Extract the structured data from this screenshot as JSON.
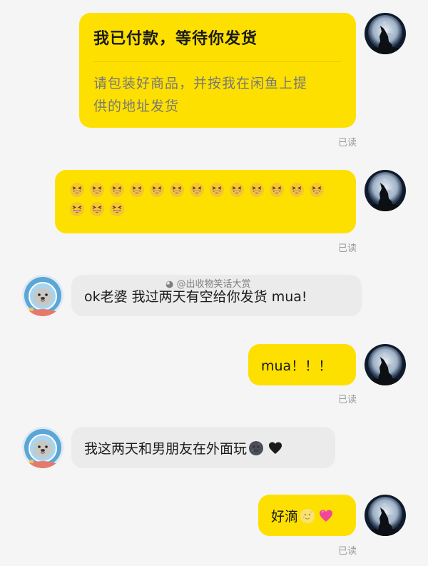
{
  "messages": [
    {
      "title": "我已付款，等待你发货",
      "desc_line1": "请包装好商品，并按我在闲鱼上提",
      "desc_line2": "供的地址发货",
      "status": "已读"
    },
    {
      "emoji": "grinning-squinting-face",
      "emoji_count": 16,
      "status": "已读"
    },
    {
      "text": "ok老婆 我过两天有空给你发货 mua!"
    },
    {
      "text": "mua！！！",
      "status": "已读"
    },
    {
      "text": "我这两天和男朋友在外面玩",
      "emojis": [
        "new-moon-face",
        "black-heart"
      ]
    },
    {
      "text": "好滴",
      "emojis": [
        "full-moon-face",
        "pink-heart"
      ],
      "status": "已读"
    }
  ],
  "watermark": "@出收物笑话大赏",
  "avatars": {
    "me": "howling-wolf-moon-avatar",
    "other": "seal-astronaut-avatar"
  },
  "colors": {
    "my_bubble": "#fee000",
    "their_bubble": "#ebebeb",
    "background": "#f5f5f5",
    "read_status": "#9a9a9a"
  }
}
